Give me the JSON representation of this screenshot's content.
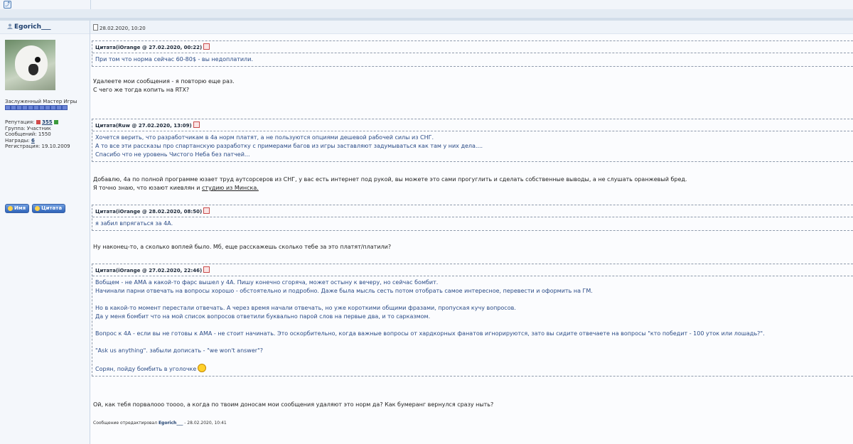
{
  "user": {
    "name": "Egorich___",
    "rank": "Заслуженный Мастер Игры",
    "pips": 11,
    "stats": {
      "reputation_label": "Репутация:",
      "reputation_value": "355",
      "group": "Группа: Участник",
      "messages": "Сообщений: 1550",
      "awards_label": "Награды:",
      "awards_value": "6",
      "registered": "Регистрация: 19.10.2009"
    },
    "buttons": {
      "name": "Имя",
      "quote": "Цитата"
    }
  },
  "post": {
    "date": "28.02.2020, 10:20",
    "quote1": {
      "header": "Цитата(iOrange @ 27.02.2020, 00:22)",
      "lines": [
        "При том что норма сейчас 60-80$ - вы недоплатили."
      ]
    },
    "text1": [
      "Удалеете мои сообщения - я повторю еще раз.",
      "С чего же тогда копить на RTX?"
    ],
    "quote2": {
      "header": "Цитата(Ruw @ 27.02.2020, 13:09)",
      "lines": [
        "Хочется верить, что разработчикам в 4а норм платят, а не пользуются опциями дешевой рабочей силы из СНГ.",
        "А то все эти рассказы про спартанскую разработку с примерами багов из игры заставляют задумываться как там у них дела....",
        "Спасибо что не уровень Чистого Неба без патчей..."
      ]
    },
    "text2": {
      "line1": "Добавлю, 4а по полной программе юзает труд аутсорсеров из СНГ, у вас есть интернет под рукой, вы можете это сами прогуглить и сделать собственные выводы, а не слушать оранжевый бред.",
      "line2_prefix": "Я точно знаю, что юзают киевлян и ",
      "line2_link": "студию из Минска."
    },
    "quote3": {
      "header": "Цитата(iOrange @ 28.02.2020, 08:50)",
      "lines": [
        "я забил впрягаться за 4А."
      ]
    },
    "text3": "Ну наконец-то, а сколько воплей было. Мб, еще расскажешь сколько тебе за это платят/платили?",
    "quote4": {
      "header": "Цитата(iOrange @ 27.02.2020, 22:46)",
      "l1": "Вобщем - не АМА а какой-то фарс вышел у 4А. Пишу конечно сгоряча, может остыну к вечеру, но сейчас бомбит.",
      "l2": "Начинали парни отвечать на вопросы хорошо - обстоятельно и подробно. Даже была мысль сесть потом отобрать самое интересное, перевести и оформить на ГМ.",
      "l3": "Но в какой-то момент перестали отвечать. А через время начали отвечать, но уже короткими общими фразами, пропуская кучу вопросов.",
      "l4": "Да у меня бомбит что на мой список вопросов ответили буквально парой слов на первые два, и то сарказмом.",
      "l5": "Вопрос к 4А - если вы не готовы к АМА - не стоит начинать. Это оскорбительно, когда важные вопросы от хардкорных фанатов игнорируются, зато вы сидите отвечаете на вопросы \"кто победит - 100 уток или лошадь?\".",
      "l6": "\"Ask us anything\". забыли дописать - \"we won't answer\"?",
      "l7": "Сорян, пойду бомбить в уголочке"
    },
    "text4": "Ой, как тебя порвалооо тоооо, а когда по твоим доносам мои сообщения удаляют это норм да? Как бумеранг вернулся сразу ныть?",
    "edited": {
      "prefix": "Сообщение отредактировал ",
      "author": "Egorich___",
      "suffix": " - 28.02.2020, 10:41"
    }
  }
}
